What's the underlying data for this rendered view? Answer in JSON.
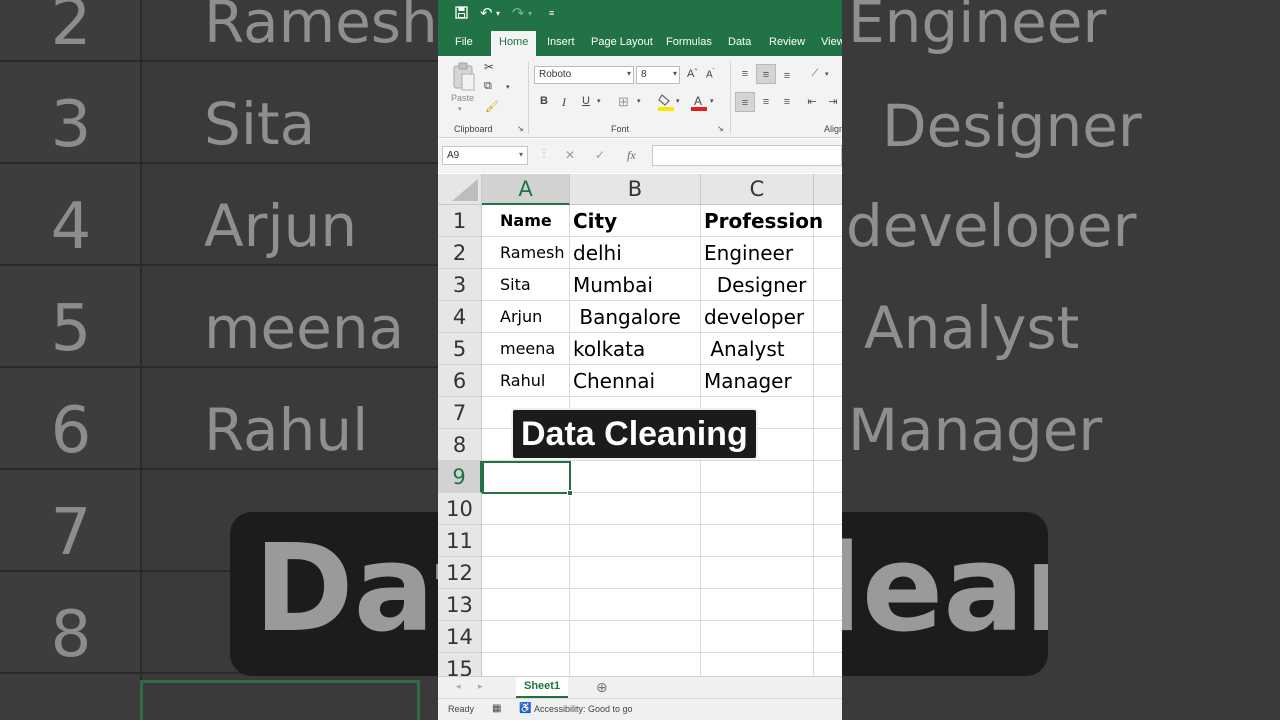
{
  "backdrop": {
    "rows": [
      {
        "num": "2",
        "name": "Ramesh",
        "prof": "Engineer"
      },
      {
        "num": "3",
        "name": "Sita",
        "prof": "Designer"
      },
      {
        "num": "4",
        "name": "Arjun",
        "prof": "developer"
      },
      {
        "num": "5",
        "name": "meena",
        "prof": "Analyst"
      },
      {
        "num": "6",
        "name": "Rahul",
        "prof": "Manager"
      },
      {
        "num": "7",
        "name": "",
        "prof": ""
      },
      {
        "num": "8",
        "name": "",
        "prof": ""
      }
    ],
    "banner_text": "Data Cleaning"
  },
  "qat": {
    "save_icon": "save-icon",
    "undo_icon": "undo-icon",
    "redo_icon": "redo-icon"
  },
  "tabs": [
    "File",
    "Home",
    "Insert",
    "Page Layout",
    "Formulas",
    "Data",
    "Review",
    "View"
  ],
  "ribbon": {
    "paste_label": "Paste",
    "clipboard_label": "Clipboard",
    "font_label": "Font",
    "alignment_label": "Alignment",
    "font_name": "Roboto",
    "font_size": "8",
    "bold": "B",
    "italic": "I",
    "underline": "U"
  },
  "formula_bar": {
    "name_box": "A9",
    "fx": "fx",
    "formula": ""
  },
  "sheet": {
    "columns": [
      "A",
      "B",
      "C"
    ],
    "row_numbers": [
      "1",
      "2",
      "3",
      "4",
      "5",
      "6",
      "7",
      "8",
      "9",
      "10",
      "11",
      "12",
      "13",
      "14",
      "15"
    ],
    "rows": [
      [
        "Name",
        "City",
        "Profession"
      ],
      [
        "Ramesh",
        "delhi",
        "Engineer"
      ],
      [
        "Sita",
        "Mumbai",
        "  Designer"
      ],
      [
        "Arjun",
        " Bangalore",
        "developer"
      ],
      [
        "meena",
        "kolkata",
        " Analyst"
      ],
      [
        "Rahul",
        "Chennai",
        "Manager"
      ]
    ],
    "selected_cell": "A9"
  },
  "overlay_title": "Data Cleaning",
  "sheet_tab": "Sheet1",
  "status": {
    "ready": "Ready",
    "accessibility": "Accessibility: Good to go"
  },
  "colors": {
    "excel_green": "#217346"
  }
}
